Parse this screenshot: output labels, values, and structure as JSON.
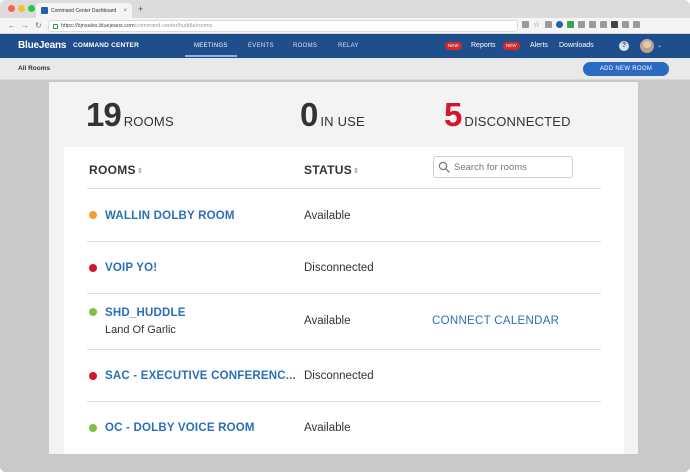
{
  "browser": {
    "tab_title": "Command Center Dashboard",
    "tab_close": "×",
    "new_tab": "+",
    "url_host": "https://bjnsales.bluejeans.com",
    "url_path": "/command-center/huddle/rooms",
    "nav_back": "←",
    "nav_forward": "→",
    "nav_reload": "↻",
    "star": "☆"
  },
  "appbar": {
    "logo": "BlueJeans",
    "product": "COMMAND CENTER",
    "nav": [
      "MEETINGS",
      "EVENTS",
      "ROOMS",
      "RELAY"
    ],
    "active_nav": "MEETINGS",
    "badge_1": "NEW",
    "reports": "Reports",
    "badge_2": "NEW",
    "alerts": "Alerts",
    "downloads": "Downloads",
    "help": "?",
    "avatar_caret": "⌄"
  },
  "subbar": {
    "title": "All Rooms",
    "add_button": "ADD NEW ROOM"
  },
  "stats": {
    "rooms_count": "19",
    "rooms_label": "ROOMS",
    "in_use_count": "0",
    "in_use_label": "IN USE",
    "disconnected_count": "5",
    "disconnected_label": "DISCONNECTED"
  },
  "table": {
    "col_rooms": "ROOMS",
    "col_status": "STATUS",
    "sort_glyph": "⇕",
    "search_placeholder": "Search for rooms",
    "rows": [
      {
        "name": "WALLIN DOLBY ROOM",
        "subtitle": "",
        "status": "Available",
        "action": "",
        "dot_color": "#f0a030"
      },
      {
        "name": "VOIP YO!",
        "subtitle": "",
        "status": "Disconnected",
        "action": "",
        "dot_color": "#d0172f"
      },
      {
        "name": "SHD_HUDDLE",
        "subtitle": "Land Of Garlic",
        "status": "Available",
        "action": "CONNECT CALENDAR",
        "dot_color": "#7cc242"
      },
      {
        "name": "SAC - EXECUTIVE CONFERENC...",
        "subtitle": "",
        "status": "Disconnected",
        "action": "",
        "dot_color": "#d0172f"
      },
      {
        "name": "OC - DOLBY VOICE ROOM",
        "subtitle": "",
        "status": "Available",
        "action": "",
        "dot_color": "#7cc242"
      }
    ]
  },
  "colors": {
    "brand_blue": "#1f4e8c",
    "link_blue": "#2a6fb8",
    "disconnected_red": "#d0172f"
  }
}
